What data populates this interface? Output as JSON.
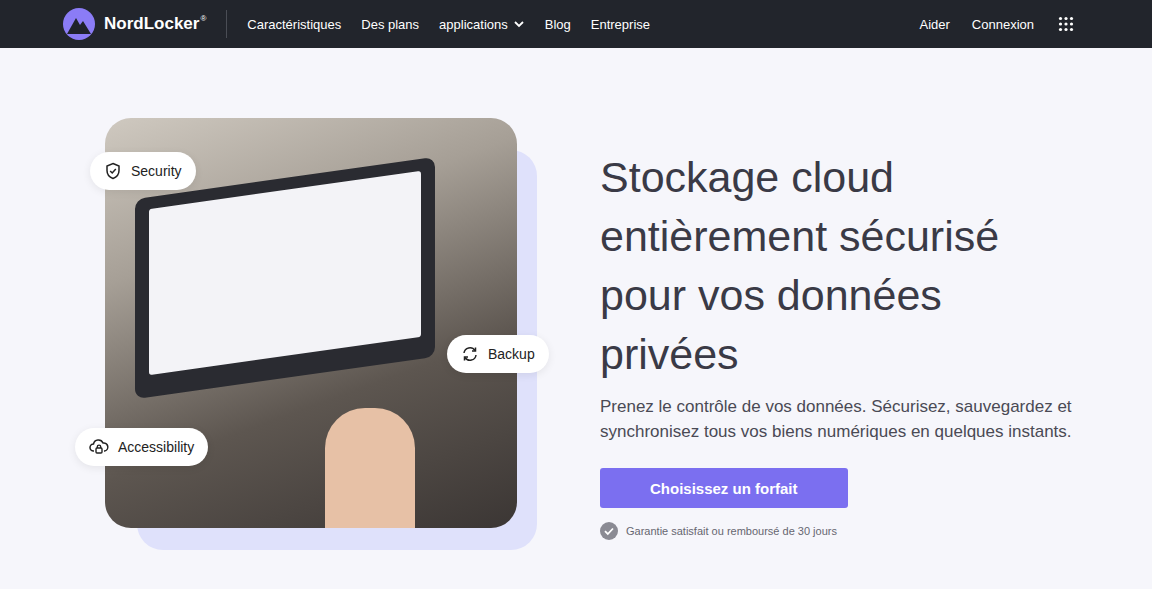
{
  "logo": {
    "name": "NordLocker",
    "mark": "®"
  },
  "nav": {
    "items": [
      {
        "label": "Caractéristiques",
        "dropdown": false
      },
      {
        "label": "Des plans",
        "dropdown": false
      },
      {
        "label": "applications",
        "dropdown": true
      },
      {
        "label": "Blog",
        "dropdown": false
      },
      {
        "label": "Entreprise",
        "dropdown": false
      }
    ],
    "right": [
      "Aider",
      "Connexion"
    ]
  },
  "hero": {
    "title": "Stockage cloud entièrement sécurisé pour vos données privées",
    "subtitle": [
      "Prenez le contrôle de vos données. Sécurisez, sauvegardez et",
      "synchronisez tous vos biens numériques en quelques instants."
    ],
    "button": "Choisissez un forfait",
    "guarantee": "Garantie satisfait ou remboursé de 30 jours"
  },
  "badges": [
    {
      "label": "Security",
      "kind": "security"
    },
    {
      "label": "Backup",
      "kind": "backup"
    },
    {
      "label": "Accessibility",
      "kind": "accessibility"
    }
  ]
}
